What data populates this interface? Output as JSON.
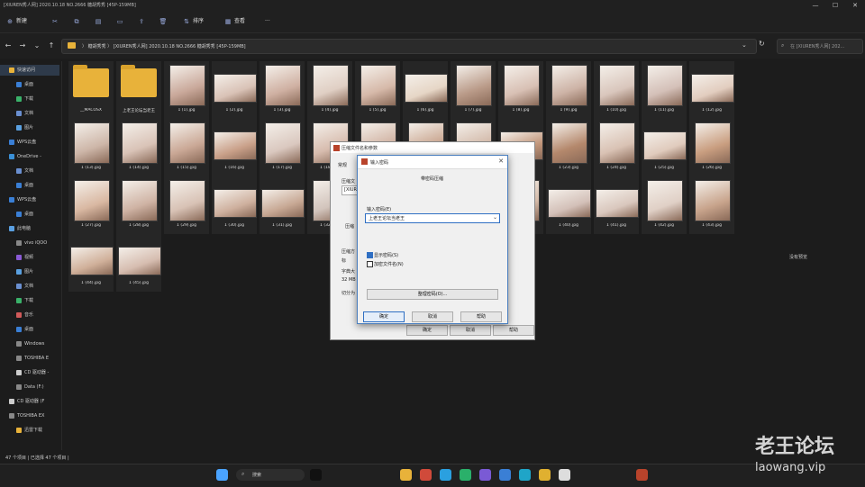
{
  "window": {
    "title": "[XIUREN秀人网] 2020.10.18 NO.2666 糖胡秀秀 [45P-159MB]",
    "minimize": "—",
    "maximize": "☐",
    "close": "✕"
  },
  "toolbar": {
    "new_label": "新建",
    "sort_label": "排序",
    "view_label": "查看",
    "more_label": "···"
  },
  "navbar": {
    "back": "←",
    "forward": "→",
    "recent": "⌄",
    "up": "↑",
    "address": "〉 糖胡秀秀 〉 [XIUREN秀人网] 2020.10.18 NO.2666 糖胡秀秀 [45P-159MB]",
    "search_placeholder": "在 [XIUREN秀人网] 202...",
    "dropdown": "⌄",
    "refresh": "↻"
  },
  "sidebar": {
    "items": [
      {
        "label": "快速访问",
        "color": "#e8b23a"
      },
      {
        "label": "桌面",
        "color": "#3a7fd5"
      },
      {
        "label": "下载",
        "color": "#3ab26a"
      },
      {
        "label": "文档",
        "color": "#6a8fd0"
      },
      {
        "label": "图片",
        "color": "#5aa0e0"
      },
      {
        "label": "WPS云盘",
        "color": "#3a7fd5"
      },
      {
        "label": "OneDrive - ",
        "color": "#3a8fd5"
      },
      {
        "label": "文档",
        "color": "#6a8fd0"
      },
      {
        "label": "桌面",
        "color": "#3a7fd5"
      },
      {
        "label": "WPS云盘",
        "color": "#3a7fd5"
      },
      {
        "label": "桌面",
        "color": "#3a7fd5"
      },
      {
        "label": "此电脑",
        "color": "#5a9fe0"
      },
      {
        "label": "vivo iQOO",
        "color": "#888888"
      },
      {
        "label": "视频",
        "color": "#8a5ad5"
      },
      {
        "label": "图片",
        "color": "#5aa0e0"
      },
      {
        "label": "文档",
        "color": "#6a8fd0"
      },
      {
        "label": "下载",
        "color": "#3ab26a"
      },
      {
        "label": "音乐",
        "color": "#d05a5a"
      },
      {
        "label": "桌面",
        "color": "#3a7fd5"
      },
      {
        "label": "Windows",
        "color": "#888888"
      },
      {
        "label": "TOSHIBA E",
        "color": "#888888"
      },
      {
        "label": "CD 驱动器 -",
        "color": "#cccccc"
      },
      {
        "label": "Data (F:)",
        "color": "#888888"
      },
      {
        "label": "CD 驱动器 (F",
        "color": "#cccccc"
      },
      {
        "label": "TOSHIBA EX",
        "color": "#888888"
      },
      {
        "label": "迅雷下载",
        "color": "#e8b23a"
      }
    ]
  },
  "files": [
    {
      "name": "__MACOSX",
      "type": "folder"
    },
    {
      "name": "上老王论坛当老王",
      "type": "folder"
    },
    {
      "name": "1 (1).jpg",
      "type": "image",
      "color": "#c9a89a"
    },
    {
      "name": "1 (2).jpg",
      "type": "image",
      "color": "#d9c2b6"
    },
    {
      "name": "1 (3).jpg",
      "type": "image",
      "color": "#cfb0a2"
    },
    {
      "name": "1 (4).jpg",
      "type": "image",
      "color": "#e0cfc4"
    },
    {
      "name": "1 (5).jpg",
      "type": "image",
      "color": "#d6b9a9"
    },
    {
      "name": "1 (6).jpg",
      "type": "image",
      "color": "#e6d6c6"
    },
    {
      "name": "1 (7).jpg",
      "type": "image",
      "color": "#b99a88"
    },
    {
      "name": "1 (8).jpg",
      "type": "image",
      "color": "#d8c0b4"
    },
    {
      "name": "1 (9).jpg",
      "type": "image",
      "color": "#cdb3a6"
    },
    {
      "name": "1 (10).jpg",
      "type": "image",
      "color": "#d9c6bc"
    },
    {
      "name": "1 (11).jpg",
      "type": "image",
      "color": "#d4c0b8"
    },
    {
      "name": "1 (12).jpg",
      "type": "image",
      "color": "#e2cdbf"
    },
    {
      "name": "1 (13).jpg",
      "type": "image",
      "color": "#cdb6a8"
    },
    {
      "name": "1 (14).jpg",
      "type": "image",
      "color": "#d9c3b7"
    },
    {
      "name": "1 (15).jpg",
      "type": "image",
      "color": "#caa896"
    },
    {
      "name": "1 (16).jpg",
      "type": "image",
      "color": "#c9a089"
    },
    {
      "name": "1 (17).jpg",
      "type": "image",
      "color": "#dac8bf"
    },
    {
      "name": "1 (18).jpg",
      "type": "image",
      "color": "#d7bcae"
    },
    {
      "name": "1 (19).jpg",
      "type": "image",
      "color": "#d0b2a2"
    },
    {
      "name": "1 (20).jpg",
      "type": "image",
      "color": "#c8a48e"
    },
    {
      "name": "1 (21).jpg",
      "type": "image",
      "color": "#d2b9a9"
    },
    {
      "name": "1 (22).jpg",
      "type": "image",
      "color": "#c2967a"
    },
    {
      "name": "1 (23).jpg",
      "type": "image",
      "color": "#b4886c"
    },
    {
      "name": "1 (24).jpg",
      "type": "image",
      "color": "#d9c2b4"
    },
    {
      "name": "1 (25).jpg",
      "type": "image",
      "color": "#e0cbbd"
    },
    {
      "name": "1 (26).jpg",
      "type": "image",
      "color": "#c99e80"
    },
    {
      "name": "1 (27).jpg",
      "type": "image",
      "color": "#d9b8a2"
    },
    {
      "name": "1 (28).jpg",
      "type": "image",
      "color": "#cfb3a4"
    },
    {
      "name": "1 (29).jpg",
      "type": "image",
      "color": "#d8c2b5"
    },
    {
      "name": "1 (30).jpg",
      "type": "image",
      "color": "#ceb09e"
    },
    {
      "name": "1 (31).jpg",
      "type": "image",
      "color": "#c7a894"
    },
    {
      "name": "1 (32).jpg",
      "type": "image",
      "color": "#d2c4bc"
    },
    {
      "name": "1 (36).jpg",
      "type": "image",
      "color": "#bf9c86"
    },
    {
      "name": "1 (37).jpg",
      "type": "image",
      "color": "#cfb0a0"
    },
    {
      "name": "1 (38).jpg",
      "type": "image",
      "color": "#c59f89"
    },
    {
      "name": "1 (39).jpg",
      "type": "image",
      "color": "#d6bcaa"
    },
    {
      "name": "1 (40).jpg",
      "type": "image",
      "color": "#d3c0b8"
    },
    {
      "name": "1 (41).jpg",
      "type": "image",
      "color": "#d9c7bd"
    },
    {
      "name": "1 (42).jpg",
      "type": "image",
      "color": "#e0d0c6"
    },
    {
      "name": "1 (43).jpg",
      "type": "image",
      "color": "#c8a48c"
    },
    {
      "name": "1 (44).jpg",
      "type": "image",
      "color": "#d0b09a"
    },
    {
      "name": "1 (45).jpg",
      "type": "image",
      "color": "#d6bdb0"
    }
  ],
  "right_pane": {
    "text": "没有预览"
  },
  "bg_dialog": {
    "title": "压缩文件名和参数",
    "tab": "常规",
    "label1": "压缩文",
    "label2": "压缩",
    "label3": "压缩方",
    "label4": "字典大",
    "label5": "切分为",
    "field1": "[XIUR",
    "field2": "标",
    "field3": "32 MB",
    "ok": "确定",
    "cancel": "取消",
    "help": "帮助"
  },
  "dialog": {
    "title": "输入密码",
    "heading": "带密码压缩",
    "label": "输入密码(E)",
    "password": "上老王论坛当老王",
    "option1": "显示密码(S)",
    "option2": "加密文件名(N)",
    "option1_checked": true,
    "option2_checked": false,
    "organize": "整理密码(O)...",
    "ok": "确定",
    "cancel": "取消",
    "help": "帮助"
  },
  "statusbar": {
    "text": "47 个项目 | 已选择 47 个项目 |"
  },
  "taskbar": {
    "search": "搜索",
    "apps": [
      {
        "name": "start",
        "color": "#4aa3ff"
      },
      {
        "name": "tiktok",
        "color": "#111111"
      },
      {
        "name": "folder",
        "color": "#e8b23a"
      },
      {
        "name": "app-red",
        "color": "#d04a3a"
      },
      {
        "name": "telegram",
        "color": "#2aa0e0"
      },
      {
        "name": "app-green",
        "color": "#2ab06a"
      },
      {
        "name": "app-purple",
        "color": "#7a5ad5"
      },
      {
        "name": "app-blue",
        "color": "#3a7fd5"
      },
      {
        "name": "edge",
        "color": "#1fa5c8"
      },
      {
        "name": "chrome",
        "color": "#e0b030"
      },
      {
        "name": "app-white",
        "color": "#dddddd"
      },
      {
        "name": "winrar",
        "color": "#b8432b"
      }
    ]
  },
  "watermark": {
    "line1": "老王论坛",
    "line2": "laowang.vip"
  }
}
